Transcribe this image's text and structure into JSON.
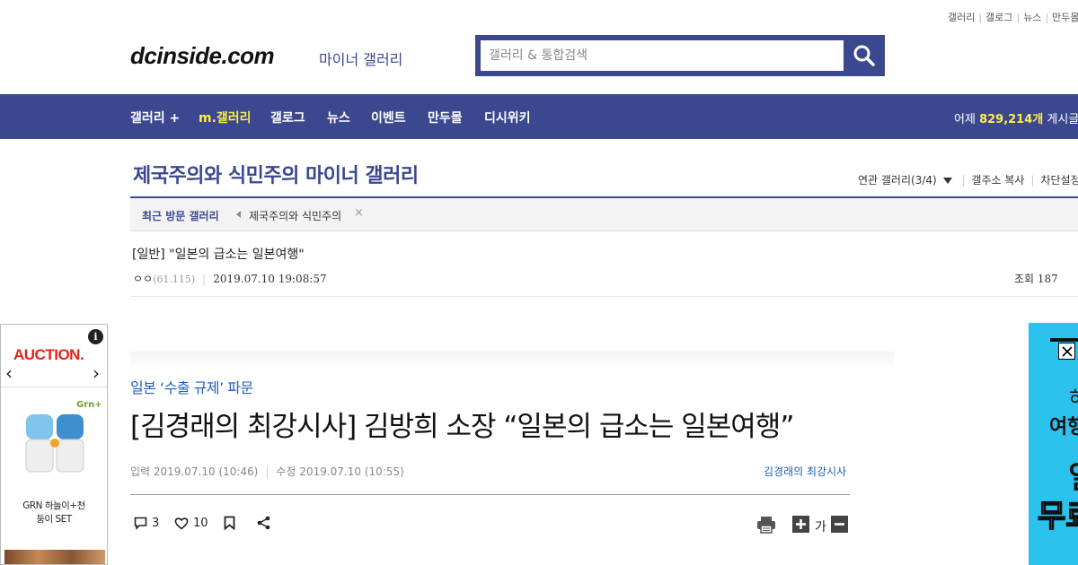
{
  "top_links": [
    "갤러리",
    "갤로그",
    "뉴스",
    "만두몰"
  ],
  "logo": "dcinside.com",
  "logo_sub": "마이너 갤러리",
  "search": {
    "placeholder": "갤러리 & 통합검색",
    "icon": "search-icon"
  },
  "nav": {
    "items": [
      "갤러리 +",
      "m.갤러리",
      "갤로그",
      "뉴스",
      "이벤트",
      "만두몰",
      "디시위키"
    ],
    "stats_prefix": "어제",
    "stats_value": "829,214개",
    "stats_suffix": "게시글"
  },
  "gallery": {
    "title": "제국주의와 식민주의 마이너 갤러리",
    "related": "연관 갤러리(3/4)",
    "copy": "갤주소 복사",
    "block": "차단설정"
  },
  "recent": {
    "label": "최근 방문 갤러리",
    "item": "제국주의와 식민주의",
    "close": "×"
  },
  "post": {
    "title": "[일반] \"일본의 급소는 일본여행\"",
    "author": "ㅇㅇ",
    "ip": "(61.115)",
    "date": "2019.07.10 19:08:57",
    "views": "조회 187"
  },
  "left_ad": {
    "brand": "AUCTION.",
    "info": "i",
    "prev": "‹",
    "next": "›",
    "product_brand": "Grn+",
    "caption_line1": "GRN 하늘이+천",
    "caption_line2": "둥이 SET"
  },
  "article": {
    "kicker": "일본 ‘수출 규제’ 파문",
    "headline": "[김경래의 최강시사] 김방희 소장 “일본의 급소는 일본여행”",
    "input_date": "입력 2019.07.10 (10:46)",
    "modify_date": "수정 2019.07.10 (10:55)",
    "column": "김경래의 최강시사",
    "comments": "3",
    "likes": "10",
    "font_label": "가"
  },
  "right_ad": {
    "t1": "하",
    "t2": "여행",
    "t3": "일",
    "t4": "무료"
  },
  "colors": {
    "brand": "#3b4890",
    "highlight": "#ffed45",
    "auction": "#e2231a",
    "news_blue": "#1f5fb8",
    "ad_bg": "#2bc2ee"
  }
}
